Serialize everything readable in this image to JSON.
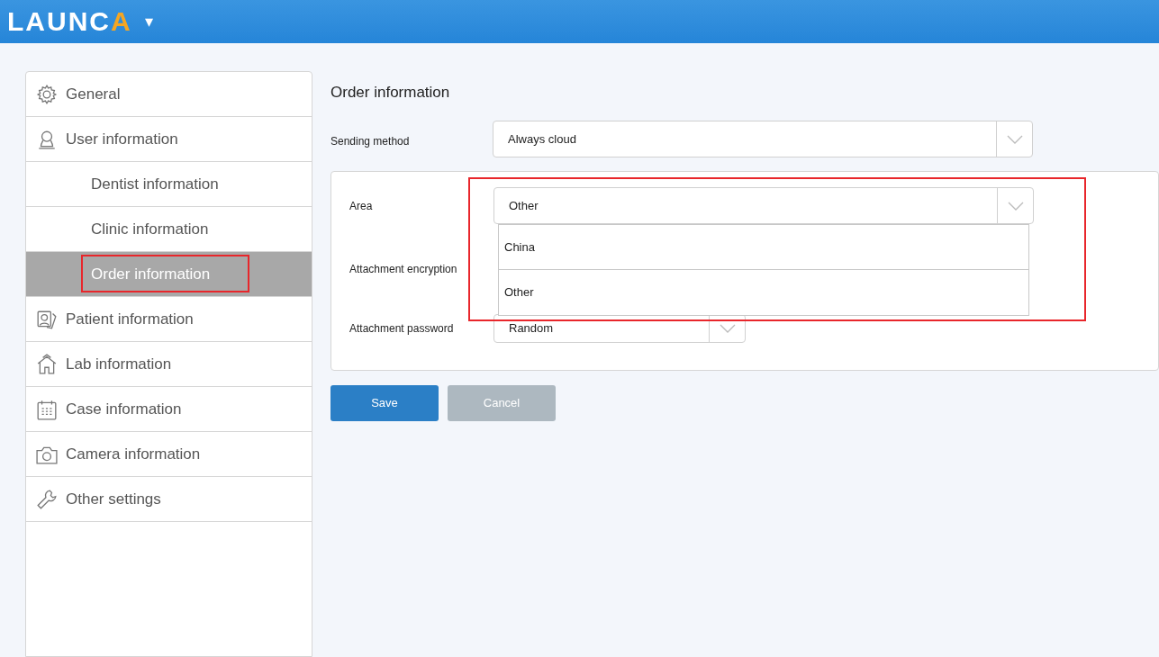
{
  "header": {
    "logo": {
      "text": "LAUNC",
      "accent": "A"
    },
    "menu_caret": "▾"
  },
  "sidebar": {
    "items": [
      {
        "label": "General",
        "selected": false
      },
      {
        "label": "User information",
        "selected": false,
        "children": [
          {
            "label": "Dentist information",
            "selected": false
          },
          {
            "label": "Clinic information",
            "selected": false
          },
          {
            "label": "Order information",
            "selected": true,
            "highlighted": true
          }
        ]
      },
      {
        "label": "Patient information",
        "selected": false
      },
      {
        "label": "Lab information",
        "selected": false
      },
      {
        "label": "Case information",
        "selected": false
      },
      {
        "label": "Camera information",
        "selected": false
      },
      {
        "label": "Other settings",
        "selected": false
      }
    ]
  },
  "content": {
    "title": "Order information",
    "sending_method": {
      "label": "Sending method",
      "value": "Always cloud"
    },
    "area": {
      "label": "Area",
      "value": "Other",
      "expanded": true,
      "highlighted": true,
      "options": [
        {
          "label": "China"
        },
        {
          "label": "Other"
        }
      ]
    },
    "attachment_encryption": {
      "label": "Attachment encryption"
    },
    "attachment_password": {
      "label": "Attachment password",
      "value": "Random"
    },
    "buttons": [
      {
        "label": "Save",
        "disabled": false
      },
      {
        "label": "Cancel",
        "disabled": true
      }
    ]
  }
}
